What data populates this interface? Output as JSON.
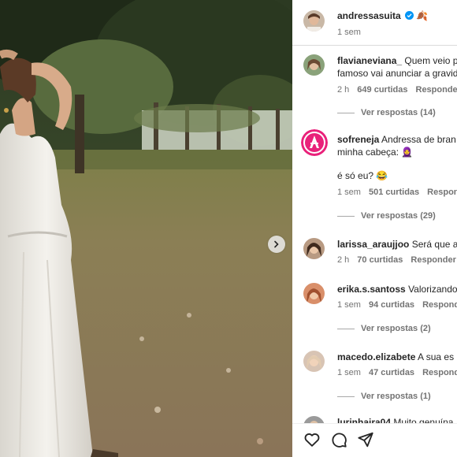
{
  "post": {
    "author": "andressasuita",
    "author_emoji": "🍂",
    "time": "1 sem"
  },
  "comments": [
    {
      "username": "flavianeviana_",
      "text_line1": "Quem veio p",
      "text_line2": "famoso vai anunciar a gravid",
      "time": "2 h",
      "likes": "649 curtidas",
      "reply": "Responde",
      "view_replies": "Ver respostas (14)"
    },
    {
      "username": "sofreneja",
      "text_line1": "Andressa de bran",
      "text_line2": "minha cabeça: 🧕",
      "text_line3": "é só eu? 😂",
      "time": "1 sem",
      "likes": "501 curtidas",
      "reply": "Respon",
      "view_replies": "Ver respostas (29)"
    },
    {
      "username": "larissa_araujjoo",
      "text_line1": "Será que a",
      "time": "2 h",
      "likes": "70 curtidas",
      "reply": "Responder"
    },
    {
      "username": "erika.s.santoss",
      "text_line1": "Valorizando",
      "time": "1 sem",
      "likes": "94 curtidas",
      "reply": "Respond",
      "view_replies": "Ver respostas (2)"
    },
    {
      "username": "macedo.elizabete",
      "text_line1": "A sua es",
      "time": "1 sem",
      "likes": "47 curtidas",
      "reply": "Responde",
      "view_replies": "Ver respostas (1)"
    },
    {
      "username": "lurinhaira04",
      "text_line1": "Muito genuína"
    }
  ],
  "actions": [
    "heart-icon",
    "comment-icon",
    "share-icon"
  ],
  "colors": {
    "verified": "#0095f6",
    "sofreneja_ring": "#e9217a",
    "text": "#262626",
    "meta": "#737373"
  }
}
